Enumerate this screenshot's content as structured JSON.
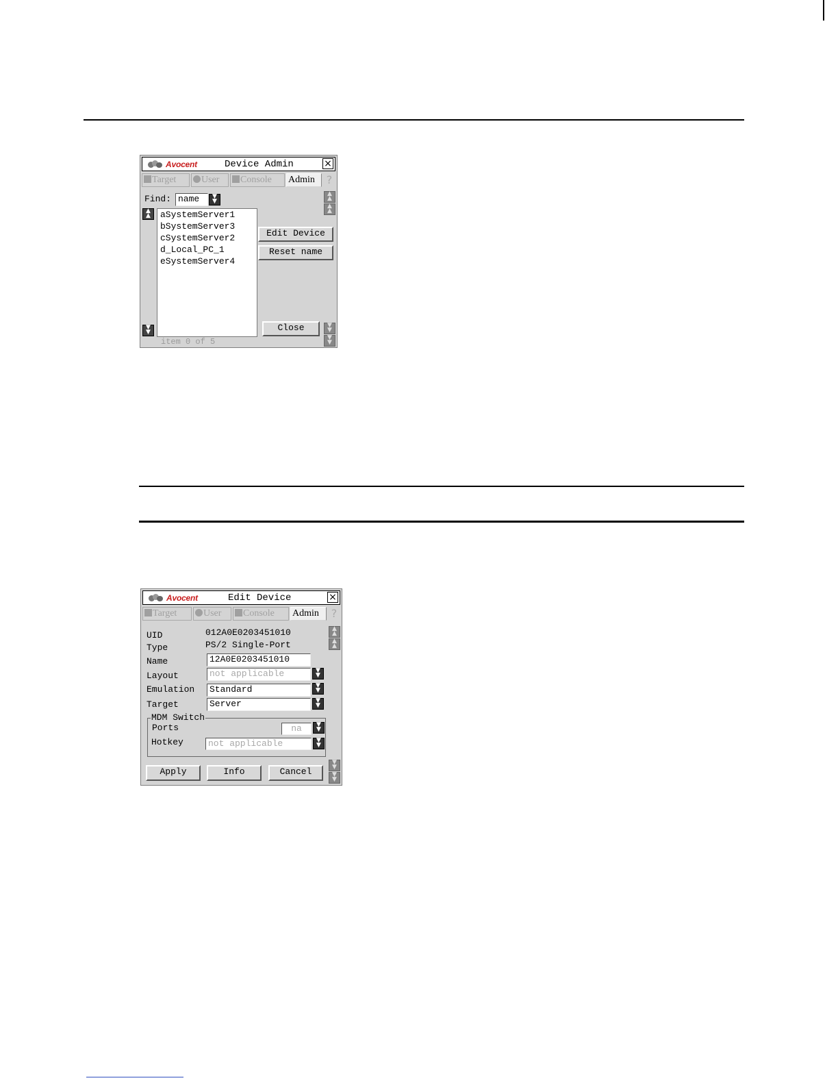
{
  "device_admin": {
    "logo_text": "Avocent",
    "title": "Device Admin",
    "tabs": [
      "Target",
      "User",
      "Console",
      "Admin"
    ],
    "help": "?",
    "find_label": "Find:",
    "find_value": "name",
    "devices": [
      "aSystemServer1",
      "bSystemServer3",
      "cSystemServer2",
      "d_Local_PC_1",
      "eSystemServer4"
    ],
    "edit_device": "Edit Device",
    "reset_name": "Reset name",
    "close": "Close",
    "status": "item 0 of 5"
  },
  "edit_device": {
    "logo_text": "Avocent",
    "title": "Edit Device",
    "tabs": [
      "Target",
      "User",
      "Console",
      "Admin"
    ],
    "help": "?",
    "labels": {
      "uid": "UID",
      "type": "Type",
      "name": "Name",
      "layout": "Layout",
      "emulation": "Emulation",
      "target": "Target",
      "mdm_switch": "MDM Switch",
      "ports": "Ports",
      "hotkey": "Hotkey"
    },
    "values": {
      "uid": "012A0E0203451010",
      "type": "PS/2 Single-Port",
      "name": "12A0E0203451010",
      "layout": "not applicable",
      "emulation": "Standard",
      "target": "Server",
      "ports": "na",
      "hotkey": "not applicable"
    },
    "apply": "Apply",
    "info": "Info",
    "cancel": "Cancel"
  },
  "icons": {
    "close": "×",
    "dropdown": "chevron-down-icon",
    "scroll_up": "chevron-up-icon",
    "scroll_down": "chevron-down-icon"
  }
}
